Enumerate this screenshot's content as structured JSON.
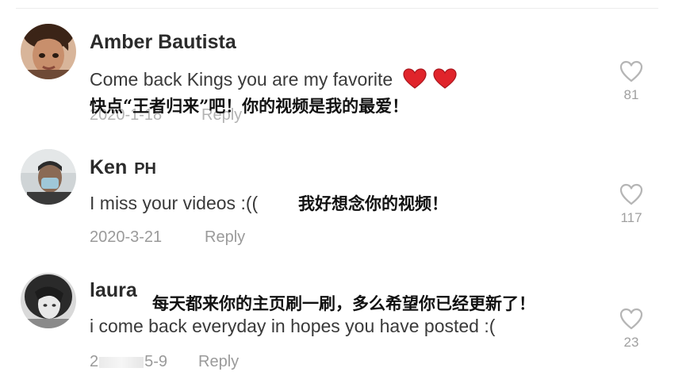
{
  "comments": [
    {
      "username": "Amber Bautista",
      "text": "Come back Kings you are my favorite",
      "date": "2020-1-18",
      "reply_label": "Reply",
      "likes": "81",
      "translation": "快点“王者归来”吧！你的视频是我的最爱！",
      "avatar_icon": "avatar-photo-icon",
      "emoji": [
        "red-heart-icon",
        "red-heart-icon"
      ]
    },
    {
      "username": "Ken",
      "username_suffix": "PH",
      "text": "I miss your videos :((",
      "date": "2020-3-21",
      "reply_label": "Reply",
      "likes": "117",
      "translation": "我好想念你的视频！",
      "avatar_icon": "avatar-photo-icon"
    },
    {
      "username": "laura",
      "text": "i come back everyday in hopes you have posted :(",
      "date_visible_start": "2",
      "date_visible_end": "5-9",
      "reply_label": "Reply",
      "likes": "23",
      "translation": "每天都来你的主页刷一刷，多么希望你已经更新了！",
      "avatar_icon": "avatar-photo-icon"
    }
  ],
  "colors": {
    "username": "#2b2b2b",
    "text": "#3a3a3a",
    "meta": "#9a9a9a",
    "heart": "#e0242b",
    "like_outline": "#b5b5b5"
  }
}
